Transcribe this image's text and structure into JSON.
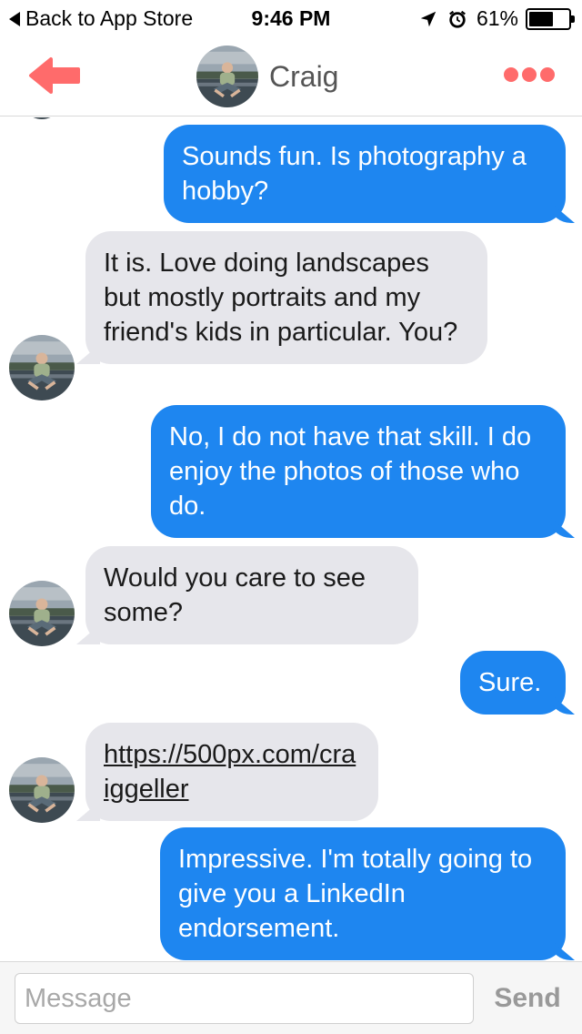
{
  "status_bar": {
    "back_label": "Back to App Store",
    "time": "9:46 PM",
    "battery": "61%",
    "battery_level": 0.61
  },
  "header": {
    "contact_name": "Craig",
    "icons": [
      "back-arrow-icon",
      "avatar",
      "more-icon"
    ],
    "accent_color": "#ff6b6b"
  },
  "messages": [
    {
      "direction": "out",
      "text": "Sounds fun. Is photography a hobby?"
    },
    {
      "direction": "in",
      "text": "It is. Love doing landscapes but mostly portraits and my friend's kids in particular. You?"
    },
    {
      "direction": "out",
      "text": "No, I do not have that skill. I do enjoy the photos of those who do."
    },
    {
      "direction": "in",
      "text": "Would you care to see some?"
    },
    {
      "direction": "out",
      "text": "Sure."
    },
    {
      "direction": "in",
      "text": "https://500px.com/craiggeller",
      "is_link": true
    },
    {
      "direction": "out",
      "text": "Impressive. I'm totally going to give you a LinkedIn endorsement."
    }
  ],
  "colors": {
    "outgoing_bubble": "#1e86f0",
    "incoming_bubble": "#e6e6eb"
  },
  "composer": {
    "placeholder": "Message",
    "send_label": "Send"
  }
}
